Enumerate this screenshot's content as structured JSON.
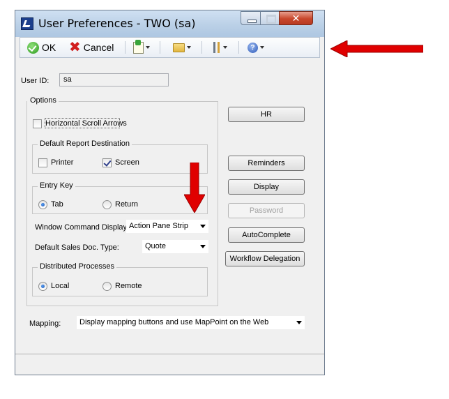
{
  "window": {
    "title": "User Preferences  -  TWO (sa)"
  },
  "toolbar": {
    "ok_label": "OK",
    "cancel_label": "Cancel"
  },
  "user": {
    "id_label": "User ID:",
    "id_value": "sa"
  },
  "options": {
    "title": "Options",
    "horizontal_scroll_label": "Horizontal Scroll Arrows",
    "horizontal_scroll_checked": false,
    "report_destination": {
      "title": "Default Report Destination",
      "printer_label": "Printer",
      "printer_checked": false,
      "screen_label": "Screen",
      "screen_checked": true
    },
    "entry_key": {
      "title": "Entry Key",
      "tab_label": "Tab",
      "return_label": "Return",
      "selected": "Tab"
    },
    "window_command_display": {
      "label": "Window Command Display",
      "value": "Action Pane Strip"
    },
    "default_sales_doc": {
      "label": "Default Sales Doc. Type:",
      "value": "Quote"
    },
    "distributed_processes": {
      "title": "Distributed Processes",
      "local_label": "Local",
      "remote_label": "Remote",
      "selected": "Local"
    }
  },
  "buttons": {
    "hr": "HR",
    "reminders": "Reminders",
    "display": "Display",
    "password": "Password",
    "autocomplete": "AutoComplete",
    "workflow_delegation": "Workflow Delegation"
  },
  "mapping": {
    "label": "Mapping:",
    "value": "Display mapping buttons and use MapPoint on the Web"
  },
  "colors": {
    "annotation_arrow": "#e00000",
    "title_bar": "#b9cfe6",
    "close_button": "#c8472c"
  }
}
